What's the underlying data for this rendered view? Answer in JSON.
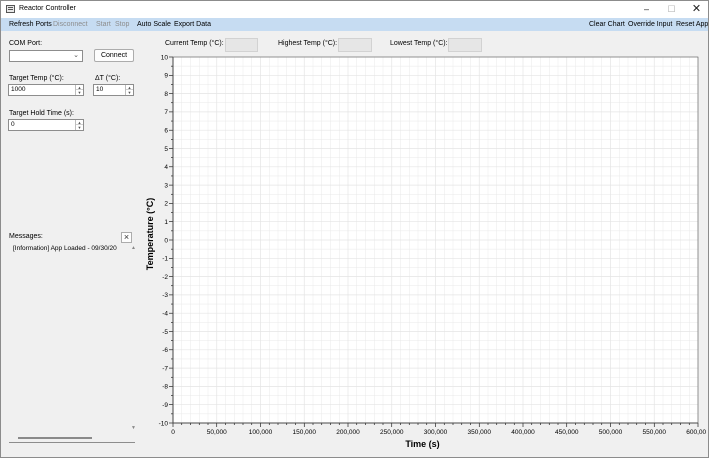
{
  "window": {
    "title": "Reactor Controller",
    "minimize": "–",
    "maximize": "☐",
    "close": "✕"
  },
  "menu": {
    "refresh_ports": "Refresh Ports",
    "disconnect": "Disconnect",
    "start": "Start",
    "stop": "Stop",
    "auto_scale": "Auto Scale",
    "export_data": "Export Data",
    "clear_chart": "Clear Chart",
    "override_input": "Override Input",
    "reset_app": "Reset App"
  },
  "controls": {
    "com_port_label": "COM Port:",
    "com_port_value": "",
    "connect_label": "Connect",
    "target_temp_label": "Target Temp (°C):",
    "target_temp_value": "1000",
    "delta_t_label": "ΔT (°C):",
    "delta_t_value": "10",
    "hold_time_label": "Target Hold Time (s):",
    "hold_time_value": "0"
  },
  "messages": {
    "label": "Messages:",
    "clear_icon": "×",
    "items": [
      "[Information] App Loaded - 09/30/20"
    ]
  },
  "readouts": {
    "current_label": "Current Temp (°C):",
    "current_value": "",
    "highest_label": "Highest Temp (°C):",
    "highest_value": "",
    "lowest_label": "Lowest Temp (°C):",
    "lowest_value": ""
  },
  "colors": {
    "menubar": "#c6dcf2",
    "disabled_text": "#8d8d8d",
    "grid": "#e4e4e4"
  },
  "chart_data": {
    "type": "line",
    "title": "",
    "xlabel": "Time (s)",
    "ylabel": "Temperature (°C)",
    "xlim": [
      0,
      600000
    ],
    "ylim": [
      -10,
      10
    ],
    "x_ticks": [
      "0",
      "50,000",
      "100,000",
      "150,000",
      "200,000",
      "250,000",
      "300,000",
      "350,000",
      "400,000",
      "450,000",
      "500,000",
      "550,000",
      "600,000"
    ],
    "y_ticks": [
      "10",
      "9",
      "8",
      "7",
      "6",
      "5",
      "4",
      "3",
      "2",
      "1",
      "0",
      "-1",
      "-2",
      "-3",
      "-4",
      "-5",
      "-6",
      "-7",
      "-8",
      "-9",
      "-10"
    ],
    "grid": true,
    "series": []
  }
}
